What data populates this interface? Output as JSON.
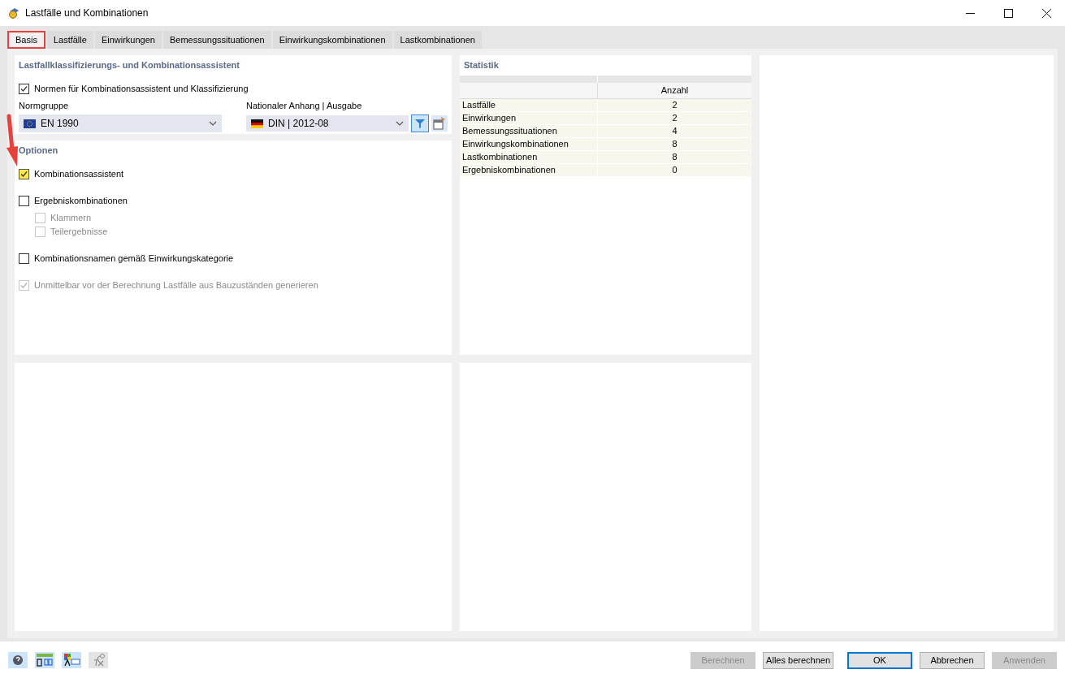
{
  "window": {
    "title": "Lastfälle und Kombinationen"
  },
  "tabs": [
    {
      "label": "Basis",
      "selected": true,
      "highlighted": true
    },
    {
      "label": "Lastfälle",
      "selected": false,
      "highlighted": false
    },
    {
      "label": "Einwirkungen",
      "selected": false,
      "highlighted": false
    },
    {
      "label": "Bemessungssituationen",
      "selected": false,
      "highlighted": false
    },
    {
      "label": "Einwirkungskombinationen",
      "selected": false,
      "highlighted": false
    },
    {
      "label": "Lastkombinationen",
      "selected": false,
      "highlighted": false
    }
  ],
  "assistant": {
    "title": "Lastfallklassifizierungs- und Kombinationsassistent",
    "norms": {
      "label": "Normen für Kombinationsassistent und Klassifizierung",
      "checked": true
    },
    "norm_group": {
      "label": "Normgruppe",
      "value": "EN 1990"
    },
    "national_annex": {
      "label": "Nationaler Anhang | Ausgabe",
      "value": "DIN | 2012-08",
      "filter_on": true
    }
  },
  "options": {
    "title": "Optionen",
    "items": [
      {
        "label": "Kombinationsassistent",
        "checked": true,
        "disabled": false,
        "highlighted": true
      },
      {
        "label": "Ergebniskombinationen",
        "checked": false,
        "disabled": false,
        "highlighted": false,
        "children": [
          {
            "label": "Klammern",
            "checked": false,
            "disabled": true
          },
          {
            "label": "Teilergebnisse",
            "checked": false,
            "disabled": true
          }
        ]
      },
      {
        "label": "Kombinationsnamen gemäß Einwirkungskategorie",
        "checked": false,
        "disabled": false,
        "highlighted": false
      },
      {
        "label": "Unmittelbar vor der Berechnung Lastfälle aus Bauzuständen generieren",
        "checked": true,
        "disabled": true
      }
    ]
  },
  "statistics": {
    "title": "Statistik",
    "column": "Anzahl",
    "rows": [
      {
        "label": "Lastfälle",
        "count": "2"
      },
      {
        "label": "Einwirkungen",
        "count": "2"
      },
      {
        "label": "Bemessungssituationen",
        "count": "4"
      },
      {
        "label": "Einwirkungskombinationen",
        "count": "8"
      },
      {
        "label": "Lastkombinationen",
        "count": "8"
      },
      {
        "label": "Ergebniskombinationen",
        "count": "0"
      }
    ]
  },
  "footer": {
    "buttons": [
      {
        "label": "Berechnen",
        "disabled": true,
        "default": false
      },
      {
        "label": "Alles berechnen",
        "disabled": false,
        "default": false
      },
      {
        "label": "OK",
        "disabled": false,
        "default": true
      },
      {
        "label": "Abbrechen",
        "disabled": false,
        "default": false
      },
      {
        "label": "Anwenden",
        "disabled": true,
        "default": false
      }
    ]
  }
}
